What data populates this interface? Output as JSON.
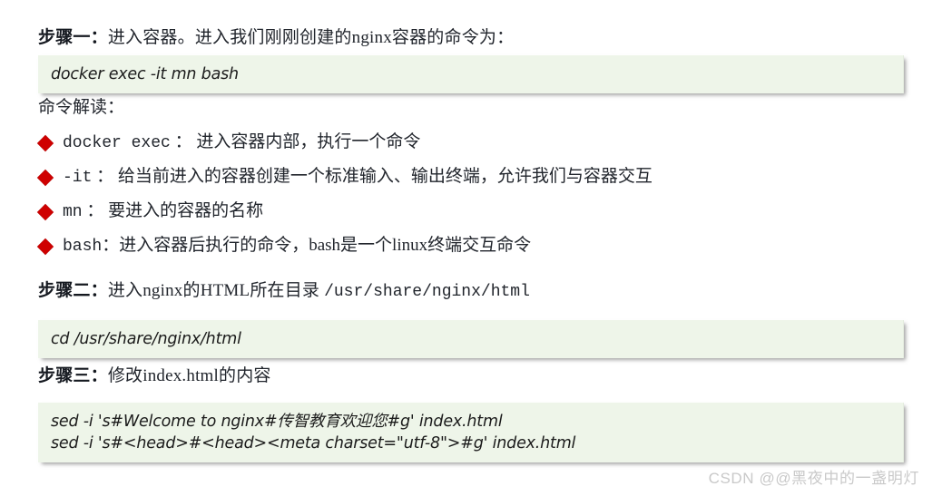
{
  "document": {
    "background_color": "#ffffff",
    "accent_bullet_color": "#cf0000",
    "code_block_bg_color": "#eef5e9",
    "text_color": "#21252c"
  },
  "steps": {
    "step1": {
      "label": "步骤一：",
      "text": "进入容器。进入我们刚刚创建的nginx容器的命令为："
    },
    "step2": {
      "label": "步骤二：",
      "text": "进入nginx的HTML所在目录 ",
      "path": "/usr/share/nginx/html"
    },
    "step3": {
      "label": "步骤三：",
      "text": "修改index.html的内容"
    }
  },
  "explain_heading": "命令解读：",
  "code_blocks": {
    "block1": {
      "lines": [
        "docker exec -it mn bash"
      ]
    },
    "block2": {
      "lines": [
        "cd /usr/share/nginx/html"
      ]
    },
    "block3": {
      "lines": [
        "sed -i 's#Welcome to nginx#传智教育欢迎您#g' index.html",
        "sed -i 's#<head>#<head><meta charset=\"utf-8\">#g' index.html"
      ]
    }
  },
  "bullets": [
    {
      "code": "docker exec",
      "desc": " ： 进入容器内部，执行一个命令"
    },
    {
      "code": "-it",
      "desc": " ： 给当前进入的容器创建一个标准输入、输出终端，允许我们与容器交互"
    },
    {
      "code": "mn",
      "desc": " ： 要进入的容器的名称"
    },
    {
      "code": "bash",
      "desc": "：进入容器后执行的命令，bash是一个linux终端交互命令"
    }
  ],
  "watermark": "CSDN @@黑夜中的一盏明灯"
}
